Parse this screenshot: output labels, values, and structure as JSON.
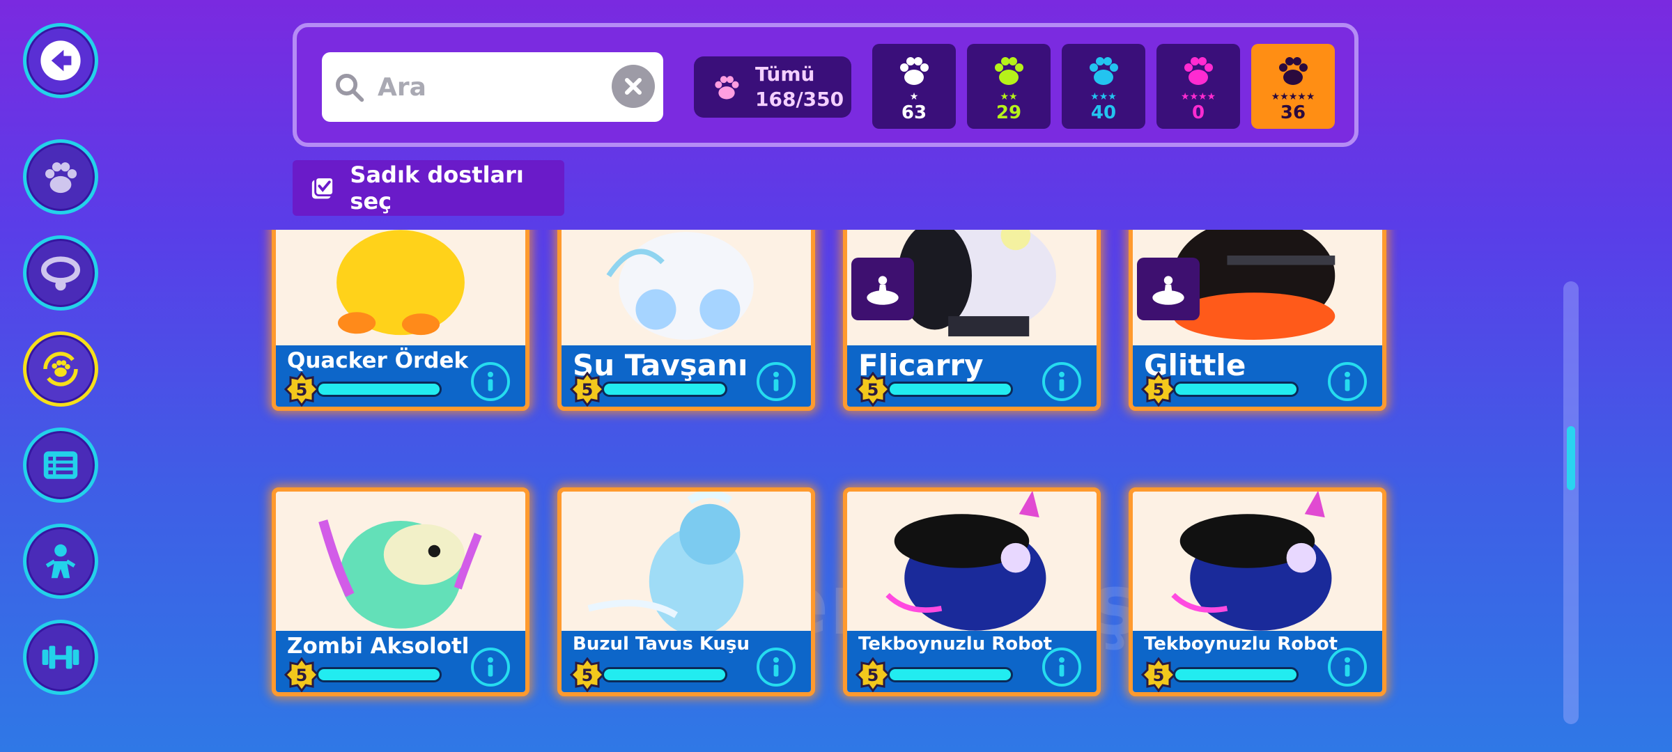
{
  "search": {
    "placeholder": "Ara"
  },
  "filters": {
    "all_label": "Tümü",
    "all_count": "168/350",
    "rarities": [
      {
        "stars": "★",
        "count": "63",
        "color": "#ffffff",
        "selected": false
      },
      {
        "stars": "★★",
        "count": "29",
        "color": "#b6f21a",
        "selected": false
      },
      {
        "stars": "★★★",
        "count": "40",
        "color": "#23c4f0",
        "selected": false
      },
      {
        "stars": "★★★★",
        "count": "0",
        "color": "#ff2bd1",
        "selected": false
      },
      {
        "stars": "★★★★★",
        "count": "36",
        "color": "#ff8e14",
        "selected": true
      }
    ]
  },
  "loyal_button": {
    "label": "Sadık dostları seç"
  },
  "pets": [
    {
      "name": "Quacker Ördek",
      "level": "5",
      "xp": 1.0,
      "ride": false
    },
    {
      "name": "Su Tavşanı",
      "level": "5",
      "xp": 1.0,
      "ride": false
    },
    {
      "name": "Flicarry",
      "level": "5",
      "xp": 1.0,
      "ride": true
    },
    {
      "name": "Glittle",
      "level": "5",
      "xp": 1.0,
      "ride": true
    },
    {
      "name": "Zombi Aksolotl",
      "level": "5",
      "xp": 1.0,
      "ride": false
    },
    {
      "name": "Buzul Tavus Kuşu",
      "level": "5",
      "xp": 1.0,
      "ride": false
    },
    {
      "name": "Tekboynuzlu Robot",
      "level": "5",
      "xp": 1.0,
      "ride": false
    },
    {
      "name": "Tekboynuzlu Robot",
      "level": "5",
      "xp": 1.0,
      "ride": false
    }
  ],
  "watermark": "itemsatış",
  "colors": {
    "accent": "#23d2ea",
    "card_border": "#ff9a2e",
    "active_ring": "#f6e01a"
  }
}
